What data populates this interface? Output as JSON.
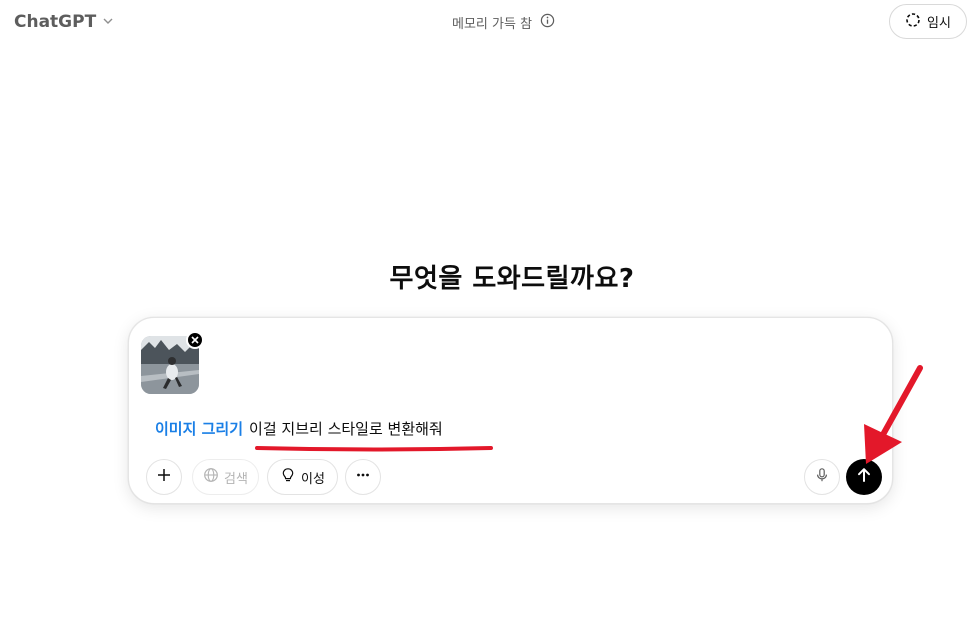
{
  "header": {
    "brand": "ChatGPT",
    "memory_status": "메모리 가득 참",
    "temporary_label": "임시"
  },
  "main": {
    "headline": "무엇을 도와드릴까요?"
  },
  "composer": {
    "tool_tag": "이미지 그리기",
    "prompt_text": "이걸 지브리 스타일로 변환해줘",
    "buttons": {
      "search_label": "검색",
      "reason_label": "이성"
    }
  },
  "colors": {
    "tool_tag": "#1a7fe6",
    "annotation": "#e3182a",
    "send_button": "#000000"
  },
  "icons": {
    "brand_chevron": "chevron-down-icon",
    "memory_info": "info-icon",
    "temporary": "dashed-circle-icon",
    "plus": "plus-icon",
    "search": "globe-icon",
    "reason": "lightbulb-icon",
    "more": "ellipsis-icon",
    "mic": "microphone-icon",
    "send": "arrow-up-icon"
  }
}
